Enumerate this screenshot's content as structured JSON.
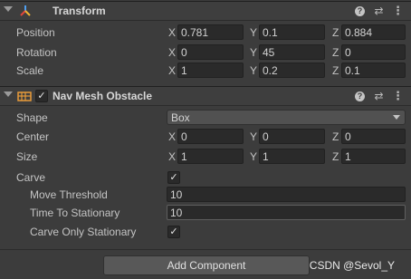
{
  "transform": {
    "title": "Transform",
    "position": {
      "label": "Position",
      "x": "0.781",
      "y": "0.1",
      "z": "0.884"
    },
    "rotation": {
      "label": "Rotation",
      "x": "0",
      "y": "45",
      "z": "0"
    },
    "scale": {
      "label": "Scale",
      "x": "1",
      "y": "0.2",
      "z": "0.1"
    }
  },
  "navmesh": {
    "title": "Nav Mesh Obstacle",
    "enabled": true,
    "shape": {
      "label": "Shape",
      "value": "Box"
    },
    "center": {
      "label": "Center",
      "x": "0",
      "y": "0",
      "z": "0"
    },
    "size": {
      "label": "Size",
      "x": "1",
      "y": "1",
      "z": "1"
    },
    "carve": {
      "label": "Carve",
      "checked": true
    },
    "move_threshold": {
      "label": "Move Threshold",
      "value": "10"
    },
    "time_to_stationary": {
      "label": "Time To Stationary",
      "value": "10"
    },
    "carve_only_stationary": {
      "label": "Carve Only Stationary",
      "checked": true
    }
  },
  "axes": {
    "x": "X",
    "y": "Y",
    "z": "Z"
  },
  "header_icons": {
    "help": "?",
    "presets": "⇄",
    "menu": "⋮"
  },
  "add_component_label": "Add Component",
  "watermark": "CSDN @Sevol_Y",
  "check_glyph": "✓",
  "colors": {
    "panel_bg": "#3c3c3c",
    "field_bg": "#2a2a2a",
    "transform_icon": [
      "#e2463b",
      "#4f9ff0",
      "#f2b632"
    ],
    "navmesh_icon": "#e89b3a"
  }
}
